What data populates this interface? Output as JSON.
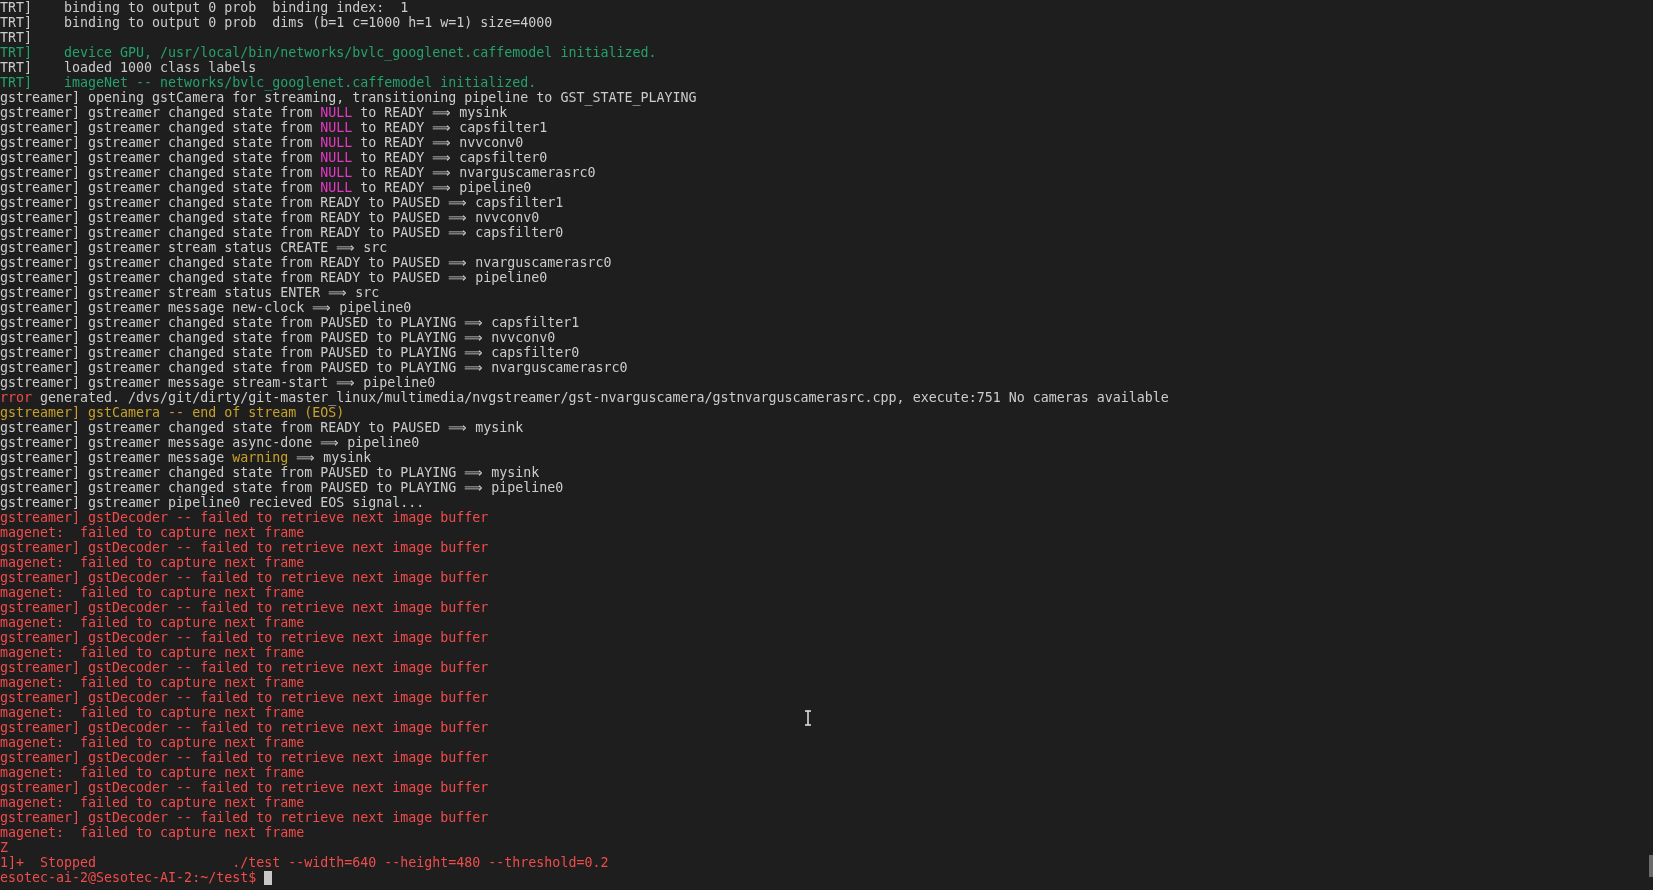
{
  "terminal": {
    "lines": [
      {
        "segments": [
          {
            "text": "TRT]    binding to output 0 prob  binding index:  1",
            "color": "#cccccc"
          }
        ]
      },
      {
        "segments": [
          {
            "text": "TRT]    binding to output 0 prob  dims (b=1 c=1000 h=1 w=1) size=4000",
            "color": "#cccccc"
          }
        ]
      },
      {
        "segments": [
          {
            "text": "TRT]",
            "color": "#cccccc"
          }
        ]
      },
      {
        "segments": [
          {
            "text": "TRT]    device GPU, /usr/local/bin/networks/bvlc_googlenet.caffemodel initialized.",
            "color": "#23a36b"
          }
        ]
      },
      {
        "segments": [
          {
            "text": "TRT]    loaded 1000 class labels",
            "color": "#cccccc"
          }
        ]
      },
      {
        "segments": [
          {
            "text": "TRT]    imageNet -- networks/bvlc_googlenet.caffemodel initialized.",
            "color": "#23a36b"
          }
        ]
      },
      {
        "segments": [
          {
            "text": "gstreamer] opening gstCamera for streaming, transitioning pipeline to GST_STATE_PLAYING",
            "color": "#cccccc"
          }
        ]
      },
      {
        "segments": [
          {
            "text": "gstreamer] gstreamer changed state from ",
            "color": "#cccccc"
          },
          {
            "text": "NULL",
            "color": "#e439c2"
          },
          {
            "text": " to READY ⟹ mysink",
            "color": "#cccccc"
          }
        ]
      },
      {
        "segments": [
          {
            "text": "gstreamer] gstreamer changed state from ",
            "color": "#cccccc"
          },
          {
            "text": "NULL",
            "color": "#e439c2"
          },
          {
            "text": " to READY ⟹ capsfilter1",
            "color": "#cccccc"
          }
        ]
      },
      {
        "segments": [
          {
            "text": "gstreamer] gstreamer changed state from ",
            "color": "#cccccc"
          },
          {
            "text": "NULL",
            "color": "#e439c2"
          },
          {
            "text": " to READY ⟹ nvvconv0",
            "color": "#cccccc"
          }
        ]
      },
      {
        "segments": [
          {
            "text": "gstreamer] gstreamer changed state from ",
            "color": "#cccccc"
          },
          {
            "text": "NULL",
            "color": "#e439c2"
          },
          {
            "text": " to READY ⟹ capsfilter0",
            "color": "#cccccc"
          }
        ]
      },
      {
        "segments": [
          {
            "text": "gstreamer] gstreamer changed state from ",
            "color": "#cccccc"
          },
          {
            "text": "NULL",
            "color": "#e439c2"
          },
          {
            "text": " to READY ⟹ nvarguscamerasrc0",
            "color": "#cccccc"
          }
        ]
      },
      {
        "segments": [
          {
            "text": "gstreamer] gstreamer changed state from ",
            "color": "#cccccc"
          },
          {
            "text": "NULL",
            "color": "#e439c2"
          },
          {
            "text": " to READY ⟹ pipeline0",
            "color": "#cccccc"
          }
        ]
      },
      {
        "segments": [
          {
            "text": "gstreamer] gstreamer changed state from READY to PAUSED ⟹ capsfilter1",
            "color": "#cccccc"
          }
        ]
      },
      {
        "segments": [
          {
            "text": "gstreamer] gstreamer changed state from READY to PAUSED ⟹ nvvconv0",
            "color": "#cccccc"
          }
        ]
      },
      {
        "segments": [
          {
            "text": "gstreamer] gstreamer changed state from READY to PAUSED ⟹ capsfilter0",
            "color": "#cccccc"
          }
        ]
      },
      {
        "segments": [
          {
            "text": "gstreamer] gstreamer stream status CREATE ⟹ src",
            "color": "#cccccc"
          }
        ]
      },
      {
        "segments": [
          {
            "text": "gstreamer] gstreamer changed state from READY to PAUSED ⟹ nvarguscamerasrc0",
            "color": "#cccccc"
          }
        ]
      },
      {
        "segments": [
          {
            "text": "gstreamer] gstreamer changed state from READY to PAUSED ⟹ pipeline0",
            "color": "#cccccc"
          }
        ]
      },
      {
        "segments": [
          {
            "text": "gstreamer] gstreamer stream status ENTER ⟹ src",
            "color": "#cccccc"
          }
        ]
      },
      {
        "segments": [
          {
            "text": "gstreamer] gstreamer message new-clock ⟹ pipeline0",
            "color": "#cccccc"
          }
        ]
      },
      {
        "segments": [
          {
            "text": "gstreamer] gstreamer changed state from PAUSED to PLAYING ⟹ capsfilter1",
            "color": "#cccccc"
          }
        ]
      },
      {
        "segments": [
          {
            "text": "gstreamer] gstreamer changed state from PAUSED to PLAYING ⟹ nvvconv0",
            "color": "#cccccc"
          }
        ]
      },
      {
        "segments": [
          {
            "text": "gstreamer] gstreamer changed state from PAUSED to PLAYING ⟹ capsfilter0",
            "color": "#cccccc"
          }
        ]
      },
      {
        "segments": [
          {
            "text": "gstreamer] gstreamer changed state from PAUSED to PLAYING ⟹ nvarguscamerasrc0",
            "color": "#cccccc"
          }
        ]
      },
      {
        "segments": [
          {
            "text": "gstreamer] gstreamer message stream-start ⟹ pipeline0",
            "color": "#cccccc"
          }
        ]
      },
      {
        "segments": [
          {
            "text": "rror",
            "color": "#f14c4c"
          },
          {
            "text": " generated. /dvs/git/dirty/git-master_linux/multimedia/nvgstreamer/gst-nvarguscamera/gstnvarguscamerasrc.cpp, execute:751 No cameras available",
            "color": "#cccccc"
          }
        ]
      },
      {
        "segments": [
          {
            "text": "gstreamer] gstCamera -- end of stream (EOS)",
            "color": "#c9a227"
          }
        ]
      },
      {
        "segments": [
          {
            "text": "gstreamer] gstreamer changed state from READY to PAUSED ⟹ mysink",
            "color": "#cccccc"
          }
        ]
      },
      {
        "segments": [
          {
            "text": "gstreamer] gstreamer message async-done ⟹ pipeline0",
            "color": "#cccccc"
          }
        ]
      },
      {
        "segments": [
          {
            "text": "gstreamer] gstreamer message ",
            "color": "#cccccc"
          },
          {
            "text": "warning",
            "color": "#c9a227"
          },
          {
            "text": " ⟹ mysink",
            "color": "#cccccc"
          }
        ]
      },
      {
        "segments": [
          {
            "text": "gstreamer] gstreamer changed state from PAUSED to PLAYING ⟹ mysink",
            "color": "#cccccc"
          }
        ]
      },
      {
        "segments": [
          {
            "text": "gstreamer] gstreamer changed state from PAUSED to PLAYING ⟹ pipeline0",
            "color": "#cccccc"
          }
        ]
      },
      {
        "segments": [
          {
            "text": "gstreamer] gstreamer pipeline0 recieved EOS signal...",
            "color": "#cccccc"
          }
        ]
      },
      {
        "segments": [
          {
            "text": "gstreamer] gstDecoder -- failed to retrieve next image buffer",
            "color": "#f14c4c"
          }
        ]
      },
      {
        "segments": [
          {
            "text": "magenet:  failed to capture next frame",
            "color": "#f14c4c"
          }
        ]
      },
      {
        "segments": [
          {
            "text": "gstreamer] gstDecoder -- failed to retrieve next image buffer",
            "color": "#f14c4c"
          }
        ]
      },
      {
        "segments": [
          {
            "text": "magenet:  failed to capture next frame",
            "color": "#f14c4c"
          }
        ]
      },
      {
        "segments": [
          {
            "text": "gstreamer] gstDecoder -- failed to retrieve next image buffer",
            "color": "#f14c4c"
          }
        ]
      },
      {
        "segments": [
          {
            "text": "magenet:  failed to capture next frame",
            "color": "#f14c4c"
          }
        ]
      },
      {
        "segments": [
          {
            "text": "gstreamer] gstDecoder -- failed to retrieve next image buffer",
            "color": "#f14c4c"
          }
        ]
      },
      {
        "segments": [
          {
            "text": "magenet:  failed to capture next frame",
            "color": "#f14c4c"
          }
        ]
      },
      {
        "segments": [
          {
            "text": "gstreamer] gstDecoder -- failed to retrieve next image buffer",
            "color": "#f14c4c"
          }
        ]
      },
      {
        "segments": [
          {
            "text": "magenet:  failed to capture next frame",
            "color": "#f14c4c"
          }
        ]
      },
      {
        "segments": [
          {
            "text": "gstreamer] gstDecoder -- failed to retrieve next image buffer",
            "color": "#f14c4c"
          }
        ]
      },
      {
        "segments": [
          {
            "text": "magenet:  failed to capture next frame",
            "color": "#f14c4c"
          }
        ]
      },
      {
        "segments": [
          {
            "text": "gstreamer] gstDecoder -- failed to retrieve next image buffer",
            "color": "#f14c4c"
          }
        ]
      },
      {
        "segments": [
          {
            "text": "magenet:  failed to capture next frame",
            "color": "#f14c4c"
          }
        ]
      },
      {
        "segments": [
          {
            "text": "gstreamer] gstDecoder -- failed to retrieve next image buffer",
            "color": "#f14c4c"
          }
        ]
      },
      {
        "segments": [
          {
            "text": "magenet:  failed to capture next frame",
            "color": "#f14c4c"
          }
        ]
      },
      {
        "segments": [
          {
            "text": "gstreamer] gstDecoder -- failed to retrieve next image buffer",
            "color": "#f14c4c"
          }
        ]
      },
      {
        "segments": [
          {
            "text": "magenet:  failed to capture next frame",
            "color": "#f14c4c"
          }
        ]
      },
      {
        "segments": [
          {
            "text": "gstreamer] gstDecoder -- failed to retrieve next image buffer",
            "color": "#f14c4c"
          }
        ]
      },
      {
        "segments": [
          {
            "text": "magenet:  failed to capture next frame",
            "color": "#f14c4c"
          }
        ]
      },
      {
        "segments": [
          {
            "text": "gstreamer] gstDecoder -- failed to retrieve next image buffer",
            "color": "#f14c4c"
          }
        ]
      },
      {
        "segments": [
          {
            "text": "magenet:  failed to capture next frame",
            "color": "#f14c4c"
          }
        ]
      },
      {
        "segments": [
          {
            "text": "Z",
            "color": "#f14c4c"
          }
        ]
      },
      {
        "segments": [
          {
            "text": "1]+  Stopped                 ./test --width=640 --height=480 --threshold=0.2",
            "color": "#f14c4c"
          }
        ]
      },
      {
        "segments": [
          {
            "text": "esotec-ai-2@Sesotec-AI-2:~/test$ ",
            "color": "#f14c4c"
          }
        ],
        "cursor": true
      }
    ]
  }
}
